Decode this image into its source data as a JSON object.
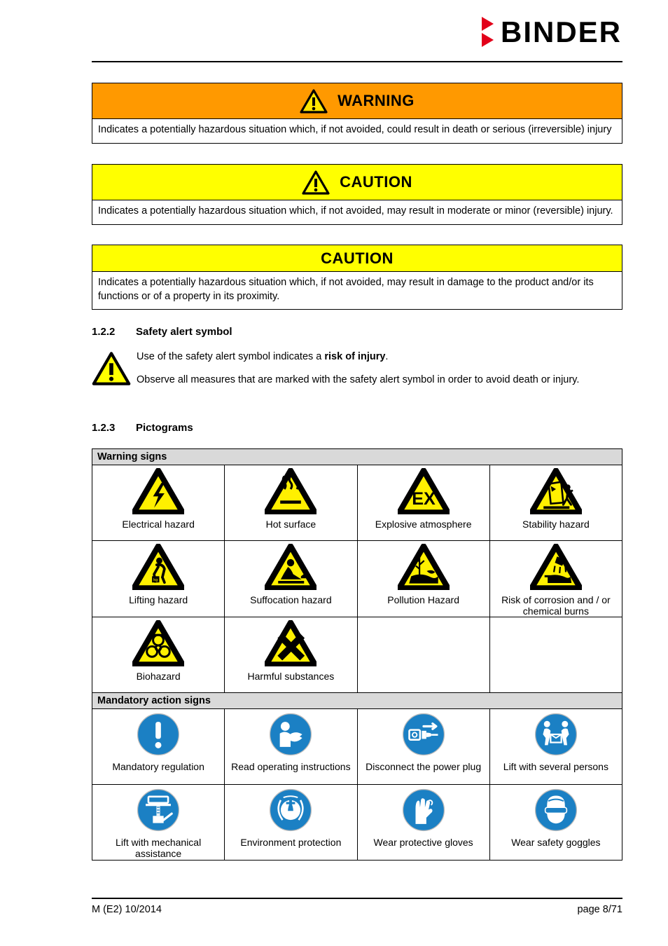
{
  "header": {
    "brand": "BINDER",
    "logo_icon": "binder-triangles-logo"
  },
  "alerts": [
    {
      "id": "warning",
      "title": "WARNING",
      "icon": "warning-triangle-icon",
      "has_icon": true,
      "band_color": "#FF9900",
      "body": "Indicates a potentially hazardous situation which, if not avoided, could result in death or serious (irreversible) injury"
    },
    {
      "id": "caution-injury",
      "title": "CAUTION",
      "icon": "warning-triangle-icon",
      "has_icon": true,
      "band_color": "#FFFF00",
      "body": "Indicates a potentially hazardous situation which, if not avoided, may result in moderate or minor (reversible) injury."
    },
    {
      "id": "caution-damage",
      "title": "CAUTION",
      "icon": null,
      "has_icon": false,
      "band_color": "#FFFF00",
      "body": "Indicates a potentially hazardous situation which, if not avoided, may result in damage to the product and/or its functions or of a property in its proximity."
    }
  ],
  "sections": {
    "safety_alert": {
      "number": "1.2.2",
      "title": "Safety alert symbol",
      "icon": "safety-alert-triangle-icon",
      "paragraph1_before": "Use of the safety alert symbol indicates a ",
      "paragraph1_bold": "risk of injury",
      "paragraph1_after": ".",
      "paragraph2": "Observe all measures that are marked with the safety alert symbol in order to avoid death or injury."
    },
    "pictograms": {
      "number": "1.2.3",
      "title": "Pictograms"
    }
  },
  "pictogram_table": {
    "groups": [
      {
        "heading": "Warning signs",
        "rows": [
          [
            {
              "label": "Electrical hazard",
              "icon": "electrical-hazard-icon",
              "empty": false
            },
            {
              "label": "Hot surface",
              "icon": "hot-surface-icon",
              "empty": false
            },
            {
              "label": "Explosive atmosphere",
              "icon": "explosive-atmosphere-icon",
              "empty": false
            },
            {
              "label": "Stability hazard",
              "icon": "stability-hazard-icon",
              "empty": false
            }
          ],
          [
            {
              "label": "Lifting hazard",
              "icon": "lifting-hazard-icon",
              "empty": false
            },
            {
              "label": "Suffocation hazard",
              "icon": "suffocation-hazard-icon",
              "empty": false
            },
            {
              "label": "Pollution Hazard",
              "icon": "pollution-hazard-icon",
              "empty": false
            },
            {
              "label": "Risk of corrosion and / or chemical burns",
              "icon": "corrosion-hazard-icon",
              "empty": false
            }
          ],
          [
            {
              "label": "Biohazard",
              "icon": "biohazard-icon",
              "empty": false
            },
            {
              "label": "Harmful substances",
              "icon": "harmful-substances-icon",
              "empty": false
            },
            {
              "label": "",
              "icon": null,
              "empty": true
            },
            {
              "label": "",
              "icon": null,
              "empty": true
            }
          ]
        ]
      },
      {
        "heading": "Mandatory action signs",
        "rows": [
          [
            {
              "label": "Mandatory regulation",
              "icon": "mandatory-regulation-icon",
              "empty": false
            },
            {
              "label": "Read operating instructions",
              "icon": "read-instructions-icon",
              "empty": false
            },
            {
              "label": "Disconnect the power plug",
              "icon": "disconnect-power-plug-icon",
              "empty": false
            },
            {
              "label": "Lift with several persons",
              "icon": "lift-several-persons-icon",
              "empty": false
            }
          ],
          [
            {
              "label": "Lift with mechanical assistance",
              "icon": "lift-mechanical-assistance-icon",
              "empty": false
            },
            {
              "label": "Environment protection",
              "icon": "environment-protection-icon",
              "empty": false
            },
            {
              "label": "Wear protective gloves",
              "icon": "protective-gloves-icon",
              "empty": false
            },
            {
              "label": "Wear safety goggles",
              "icon": "safety-goggles-icon",
              "empty": false
            }
          ]
        ]
      }
    ]
  },
  "footer": {
    "document_code": "M (E2) 10/2014",
    "page_label": "page 8/71"
  },
  "colors": {
    "warning_orange": "#FF9900",
    "caution_yellow": "#FFFF00",
    "brand_red": "#E2001A",
    "mandatory_blue": "#1B80C4",
    "table_head_gray": "#D9D9D9"
  }
}
